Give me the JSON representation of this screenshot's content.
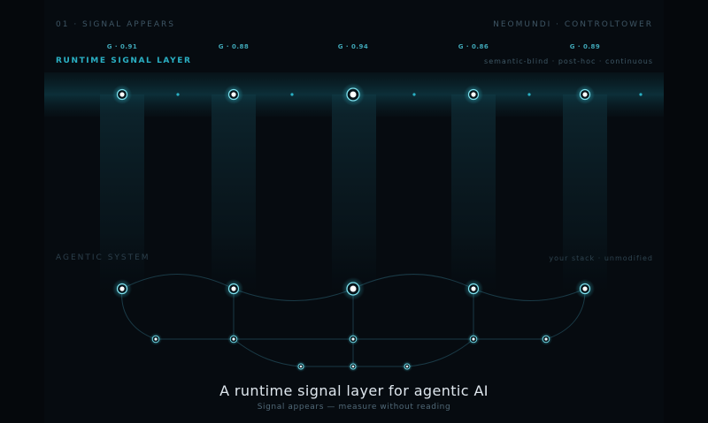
{
  "header": {
    "section_label": "01 · SIGNAL APPEARS",
    "brand": "NEOMUNDI · CONTROLTOWER"
  },
  "signal_layer": {
    "title": "RUNTIME SIGNAL LAYER",
    "tagline": "semantic-blind · post-hoc · continuous",
    "readings": [
      "G · 0.91",
      "G · 0.88",
      "G · 0.94",
      "G · 0.86",
      "G · 0.89"
    ]
  },
  "agentic_system": {
    "title": "AGENTIC SYSTEM",
    "tagline": "your stack · unmodified"
  },
  "caption": {
    "title": "A runtime signal layer for agentic AI",
    "subtitle": "Signal appears — measure without reading"
  },
  "colors": {
    "accent": "#2ab0c4",
    "node_ring": "#7fe3f0",
    "background": "#05080c"
  }
}
